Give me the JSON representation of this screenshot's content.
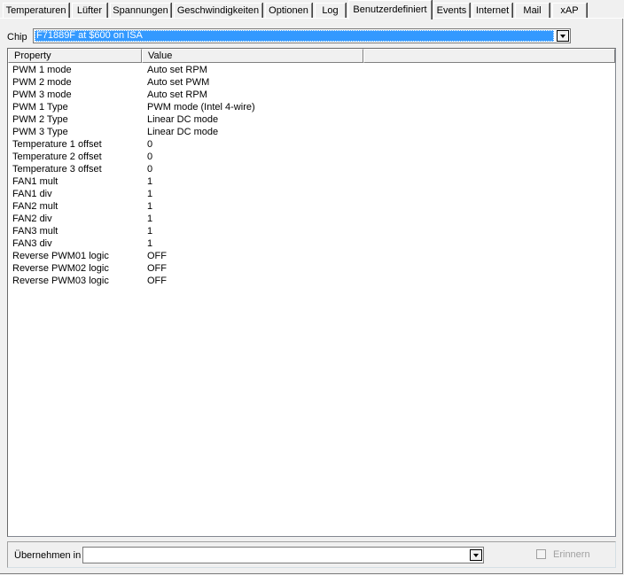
{
  "tabs": [
    {
      "label": "Temperaturen",
      "active": false
    },
    {
      "label": "Lüfter",
      "active": false
    },
    {
      "label": "Spannungen",
      "active": false
    },
    {
      "label": "Geschwindigkeiten",
      "active": false
    },
    {
      "label": "Optionen",
      "active": false
    },
    {
      "label": "Log",
      "active": false
    },
    {
      "label": "Benutzerdefiniert",
      "active": true
    },
    {
      "label": "Events",
      "active": false
    },
    {
      "label": "Internet",
      "active": false
    },
    {
      "label": "Mail",
      "active": false
    },
    {
      "label": "xAP",
      "active": false
    }
  ],
  "chip": {
    "label": "Chip",
    "selected": "F71889F at $600 on ISA"
  },
  "list": {
    "columns": [
      "Property",
      "Value"
    ],
    "rows": [
      {
        "property": "PWM 1 mode",
        "value": "Auto set RPM"
      },
      {
        "property": "PWM 2 mode",
        "value": "Auto set PWM"
      },
      {
        "property": "PWM 3 mode",
        "value": "Auto set RPM"
      },
      {
        "property": "PWM 1 Type",
        "value": "PWM mode (Intel 4-wire)"
      },
      {
        "property": "PWM 2 Type",
        "value": "Linear DC mode"
      },
      {
        "property": "PWM 3 Type",
        "value": "Linear DC mode"
      },
      {
        "property": "Temperature 1 offset",
        "value": "0"
      },
      {
        "property": "Temperature 2 offset",
        "value": "0"
      },
      {
        "property": "Temperature 3 offset",
        "value": "0"
      },
      {
        "property": "FAN1 mult",
        "value": "1"
      },
      {
        "property": "FAN1 div",
        "value": "1"
      },
      {
        "property": "FAN2 mult",
        "value": "1"
      },
      {
        "property": "FAN2 div",
        "value": "1"
      },
      {
        "property": "FAN3 mult",
        "value": "1"
      },
      {
        "property": "FAN3 div",
        "value": "1"
      },
      {
        "property": "Reverse PWM01 logic",
        "value": "OFF"
      },
      {
        "property": "Reverse PWM02 logic",
        "value": "OFF"
      },
      {
        "property": "Reverse PWM03 logic",
        "value": "OFF"
      }
    ]
  },
  "apply": {
    "label": "Übernehmen in",
    "value": ""
  },
  "remind": {
    "label": "Erinnern",
    "checked": false,
    "enabled": false
  },
  "colors": {
    "selection": "#3399ff",
    "window_bg": "#f0f0f0",
    "disabled_text": "#a0a0a0"
  }
}
